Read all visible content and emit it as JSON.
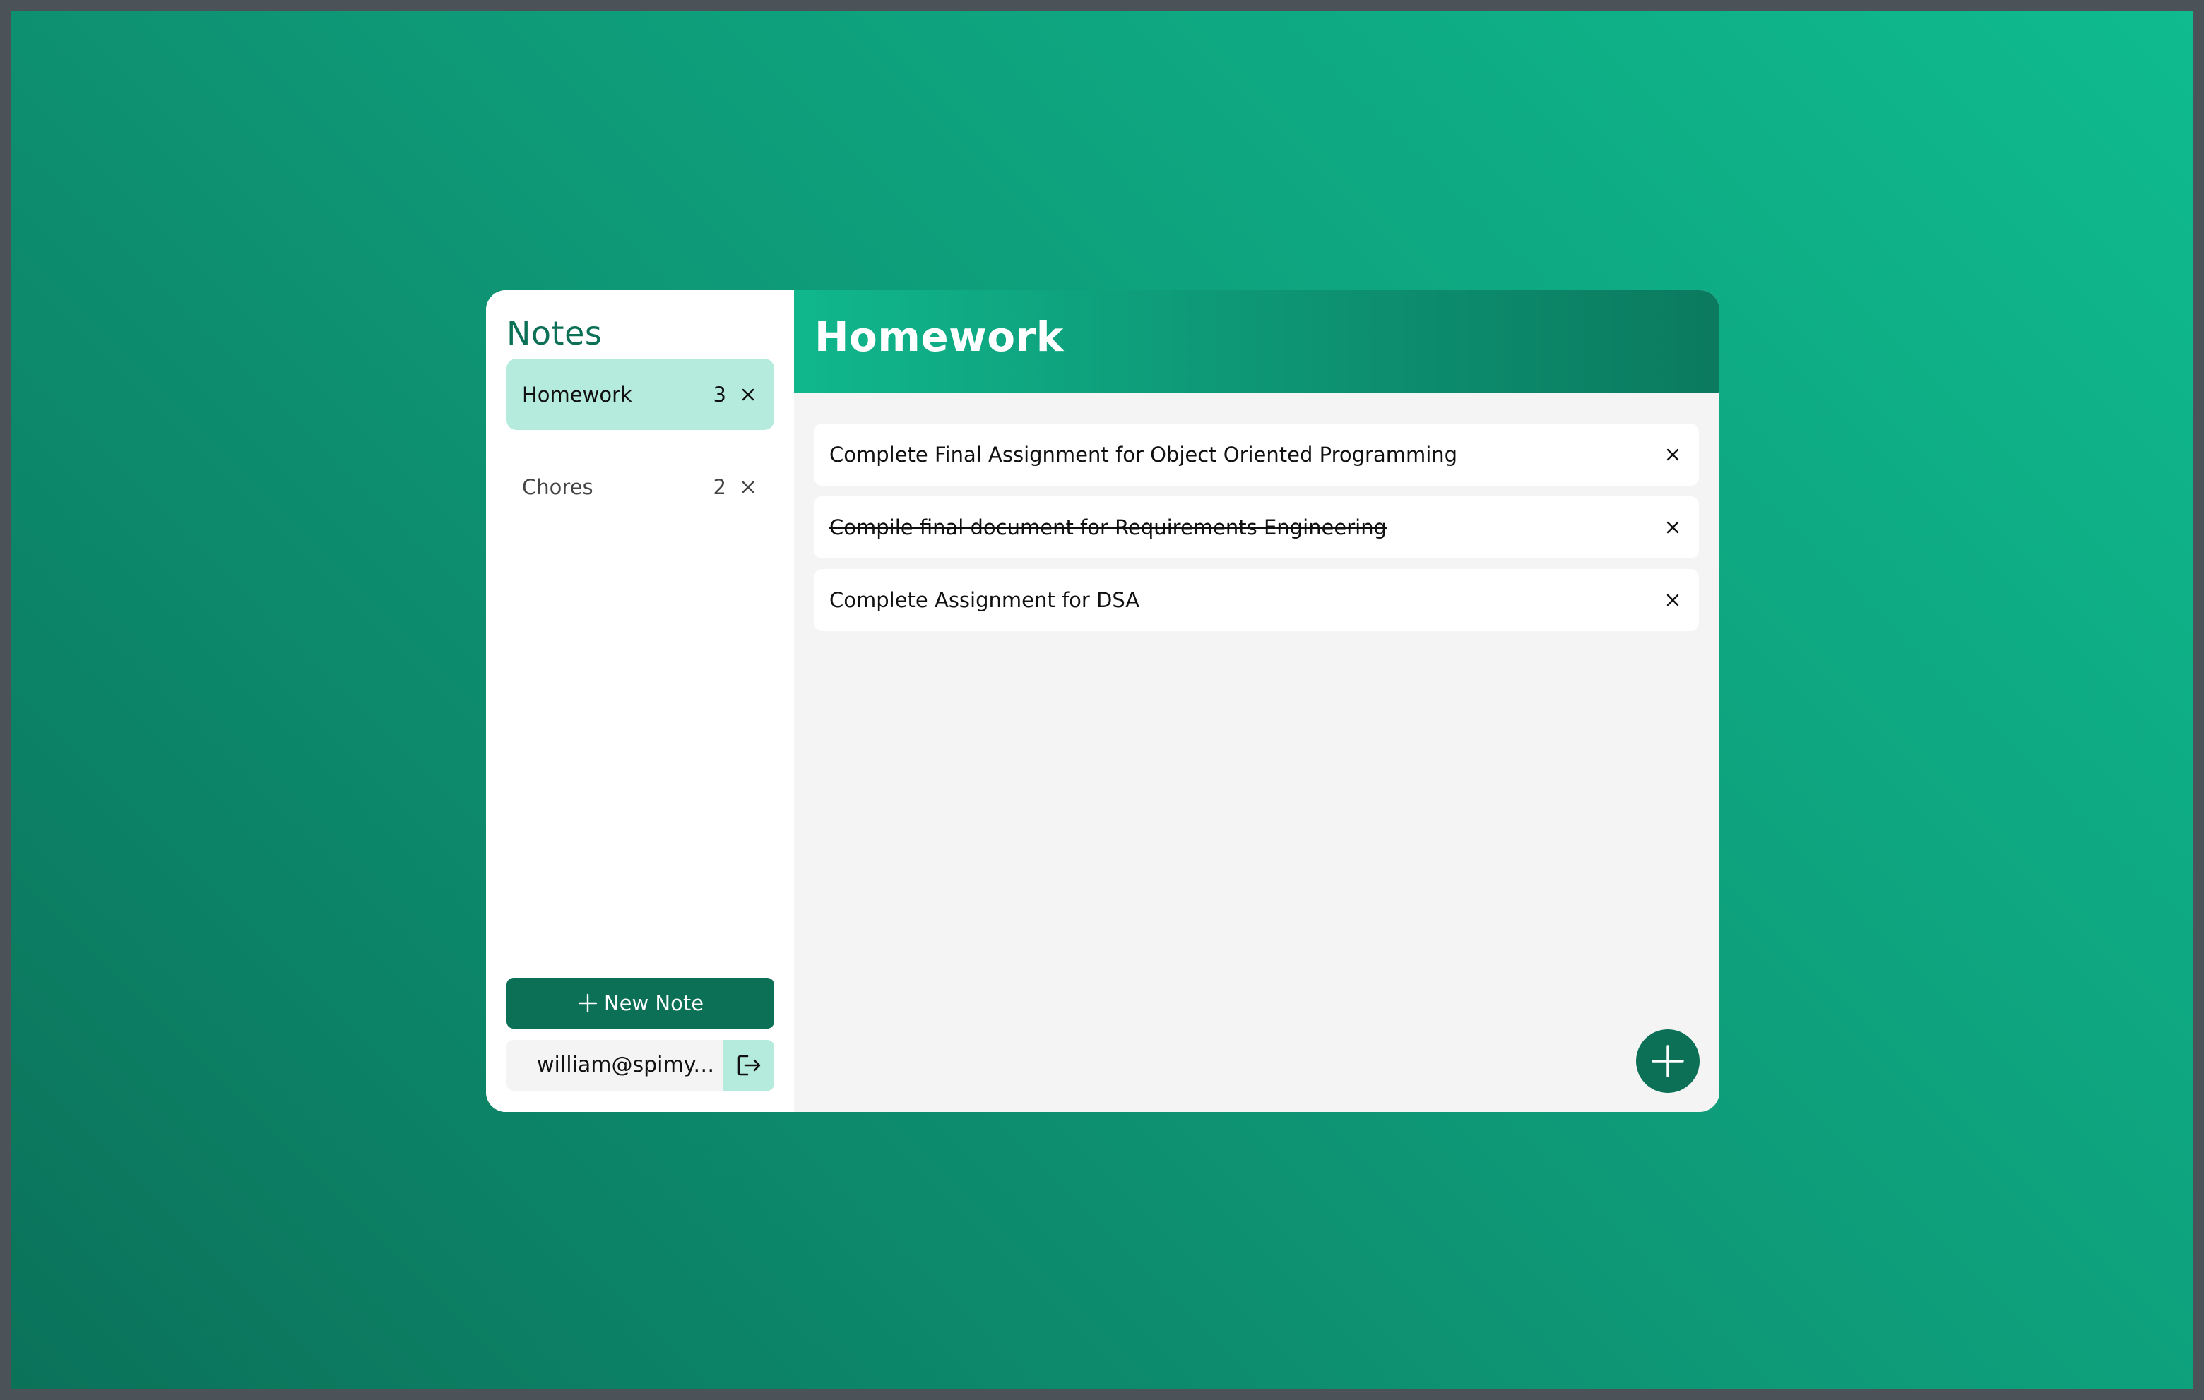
{
  "sidebar": {
    "title": "Notes",
    "notes": [
      {
        "label": "Homework",
        "count": "3",
        "active": true
      },
      {
        "label": "Chores",
        "count": "2",
        "active": false
      }
    ],
    "new_note_label": "New Note",
    "user_email": "william@spimy...."
  },
  "main": {
    "title": "Homework",
    "todos": [
      {
        "text": "Complete Final Assignment for Object Oriented Programming",
        "done": false
      },
      {
        "text": "Compile final document for Requirements Engineering",
        "done": true
      },
      {
        "text": "Complete Assignment for DSA",
        "done": false
      }
    ]
  },
  "colors": {
    "accent": "#0b7056",
    "accent_light": "#b5ebdc",
    "header_start": "#10b78d",
    "header_end": "#0b7a5f"
  },
  "icons": {
    "delete": "close-icon",
    "new_note": "plus-icon",
    "logout": "logout-icon",
    "add_todo": "plus-icon"
  }
}
